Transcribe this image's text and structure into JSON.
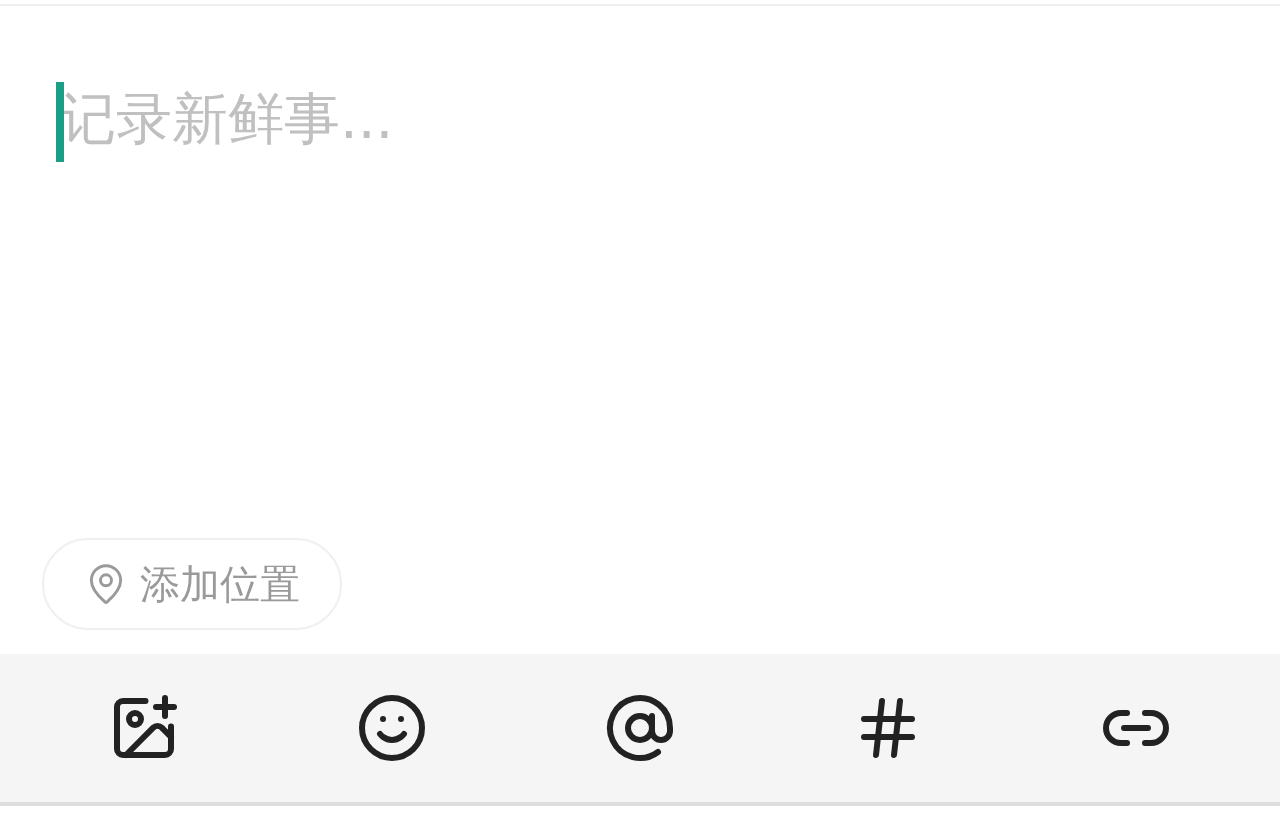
{
  "composer": {
    "placeholder": "记录新鲜事..."
  },
  "location_button": {
    "label": "添加位置"
  },
  "toolbar": [
    {
      "kind": "image"
    },
    {
      "kind": "emoji"
    },
    {
      "kind": "mention"
    },
    {
      "kind": "topic"
    },
    {
      "kind": "link"
    }
  ]
}
